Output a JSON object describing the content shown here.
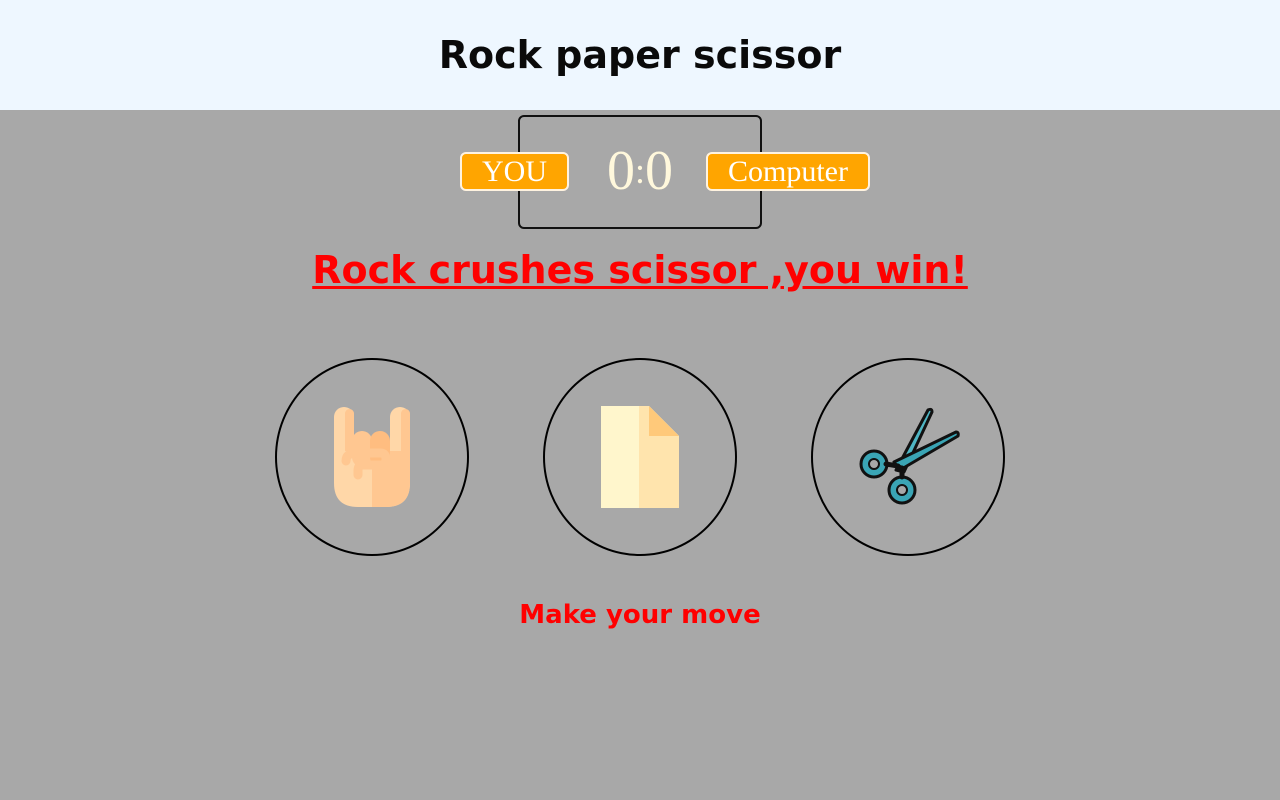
{
  "header": {
    "title": "Rock paper scissor"
  },
  "scoreboard": {
    "user_label": "YOU",
    "computer_label": "Computer",
    "user_score": "0",
    "separator": ":",
    "computer_score": "0"
  },
  "result": {
    "text": "Rock crushes scissor ,you win!"
  },
  "choices": [
    {
      "id": "rock",
      "icon": "rock-hand-icon"
    },
    {
      "id": "paper",
      "icon": "paper-icon"
    },
    {
      "id": "scissor",
      "icon": "scissors-icon"
    }
  ],
  "message": {
    "text": "Make your move"
  },
  "colors": {
    "header_bg": "#eef7ff",
    "page_bg": "#a8a8a8",
    "badge_bg": "#ffa500",
    "accent_red": "#ff0000",
    "score_text": "#fff8dc"
  }
}
